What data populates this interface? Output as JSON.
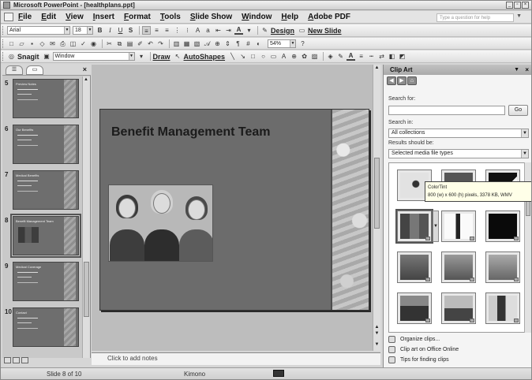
{
  "window": {
    "title": "Microsoft PowerPoint - [healthplans.ppt]"
  },
  "menu": {
    "items": [
      "File",
      "Edit",
      "View",
      "Insert",
      "Format",
      "Tools",
      "Slide Show",
      "Window",
      "Help",
      "Adobe PDF"
    ],
    "ask_placeholder": "Type a question for help"
  },
  "toolbar1": {
    "font": "Arial",
    "size": "18",
    "bold": "B",
    "italic": "I",
    "underline": "U",
    "shadow": "S",
    "font_color": "A",
    "design": "Design",
    "new_slide": "New Slide"
  },
  "toolbar2": {
    "zoom": "54%"
  },
  "toolbar3": {
    "snagit": "Snagit",
    "window": "Window",
    "draw": "Draw",
    "autoshapes": "AutoShapes"
  },
  "left_pane": {
    "close": "×",
    "slides": [
      {
        "num": "5",
        "title": "Preview Notes"
      },
      {
        "num": "6",
        "title": "Our Benefits"
      },
      {
        "num": "7",
        "title": "Medical Benefits"
      },
      {
        "num": "8",
        "title": "Benefit Management Team",
        "selected": true
      },
      {
        "num": "9",
        "title": "Medical Coverage"
      },
      {
        "num": "10",
        "title": "Contact"
      }
    ]
  },
  "slide": {
    "title": "Benefit Management Team"
  },
  "notes": {
    "placeholder": "Click to add notes"
  },
  "status": {
    "slide": "Slide 8 of 10",
    "theme": "Kimono"
  },
  "task_pane": {
    "title": "Clip Art",
    "search_for_label": "Search for:",
    "go_label": "Go",
    "search_in_label": "Search in:",
    "search_in_value": "All collections",
    "results_label": "Results should be:",
    "results_value": "Selected media file types",
    "tooltip_name": "ColorTint",
    "tooltip_info": "800 (w) x 600 (h) pixels, 3378 KB, WMV",
    "links": [
      "Organize clips...",
      "Clip art on Office Online",
      "Tips for finding clips"
    ]
  },
  "colors": {
    "slide_bg": "#6c6c6c",
    "title_text": "#1b1b1b",
    "pane_bg": "#f4f4f4"
  }
}
